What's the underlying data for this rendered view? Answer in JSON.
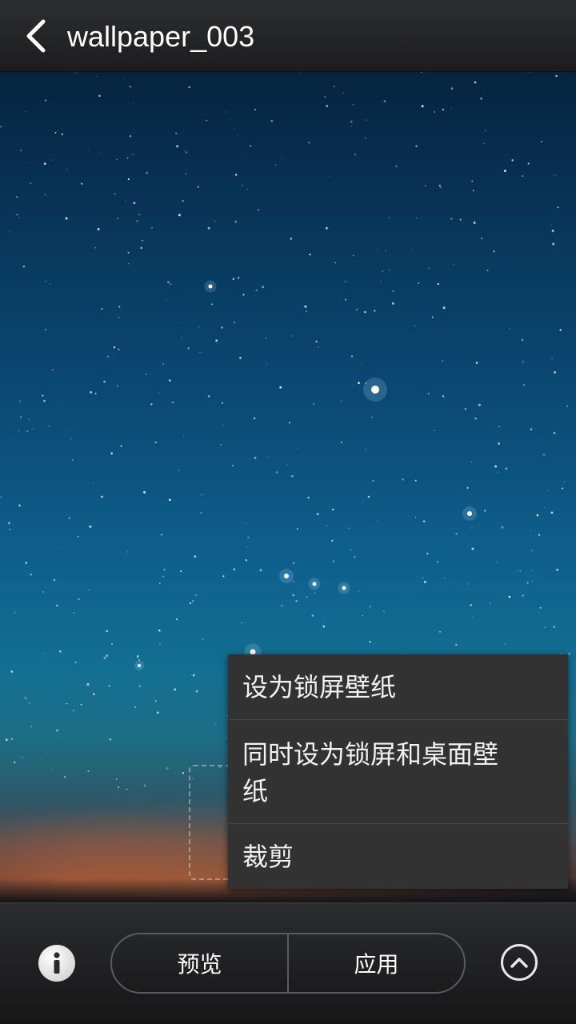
{
  "header": {
    "title": "wallpaper_003",
    "back_icon": "chevron-left-icon"
  },
  "popup_menu": {
    "items": [
      {
        "label": "设为锁屏壁纸"
      },
      {
        "label_line1": "同时设为锁屏和桌面壁",
        "label_line2": "纸"
      },
      {
        "label": "裁剪"
      }
    ]
  },
  "bottom_bar": {
    "info_icon": "info-icon",
    "preview_label": "预览",
    "apply_label": "应用",
    "expand_icon": "chevron-up-circle-icon"
  },
  "colors": {
    "header_bg": "#1c1c1e",
    "menu_bg": "#323232",
    "menu_divider": "#4b4b4b",
    "bottom_bar_bg": "#1e1e1f"
  }
}
